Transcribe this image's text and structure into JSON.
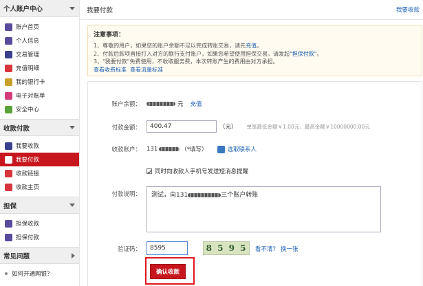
{
  "sidebar": {
    "sections": [
      {
        "title": "个人账户中心",
        "items": [
          {
            "label": "账户首页",
            "icon": "home-icon"
          },
          {
            "label": "个人信息",
            "icon": "user-icon"
          },
          {
            "label": "交易管理",
            "icon": "transaction-icon"
          },
          {
            "label": "充值明细",
            "icon": "recharge-icon"
          },
          {
            "label": "我的银行卡",
            "icon": "bank-card-icon"
          },
          {
            "label": "电子对账单",
            "icon": "statement-icon"
          },
          {
            "label": "安全中心",
            "icon": "security-icon"
          }
        ]
      },
      {
        "title": "收款付款",
        "items": [
          {
            "label": "我要收款",
            "icon": "receive-icon"
          },
          {
            "label": "我要付款",
            "icon": "pay-icon",
            "active": true
          },
          {
            "label": "收款链接",
            "icon": "link-icon"
          },
          {
            "label": "收款主页",
            "icon": "homepage-icon"
          }
        ]
      },
      {
        "title": "担保",
        "items": [
          {
            "label": "担保收款",
            "icon": "guarantee-receive-icon"
          },
          {
            "label": "担保付款",
            "icon": "guarantee-pay-icon"
          }
        ]
      },
      {
        "title": "常见问题",
        "items": [
          {
            "label": "如何开通网银？"
          }
        ]
      }
    ]
  },
  "header": {
    "title": "我要付款",
    "right_link": "我要收款"
  },
  "notice": {
    "title": "注意事项：",
    "line1_a": "1、尊敬的用户，如果您的账户余额不足以完成转账交易，请先",
    "line1_link": "充值",
    "line1_b": "。",
    "line2_a": "2、付款后款项直接打入对方的联行支付账户，如果您希望使用担保交易，请发起",
    "line2_link": "\"担保付款\"",
    "line2_b": "。",
    "line3": "3、\"我要付款\"免费使用，不收取服务费，本次转账产生的费用由对方承担。",
    "link_a": "查看收费标准",
    "link_b": "查看流量标准"
  },
  "form": {
    "balance_label": "账户余额：",
    "balance_unit": "元",
    "recharge_link": "充值",
    "amount_label": "付款金额：",
    "amount_value": "400.47",
    "amount_unit": "（元）",
    "amount_hint": "单笔最低金额￥1.00元，最高金额￥10000000.00元",
    "account_label": "收款账户：",
    "account_prefix": "131",
    "account_note": "（*填写）",
    "select_contact": "选取联系人",
    "sms_notify": "同时向收款人手机号发送短消息提醒",
    "remark_label": "付款说明：",
    "remark_prefix": "测试，向131",
    "remark_suffix": "三个账户转账",
    "captcha_label": "验证码：",
    "captcha_value": "8595",
    "captcha_image": [
      "8",
      "5",
      "9",
      "5"
    ],
    "captcha_refresh_a": "看不清？",
    "captcha_refresh_b": "换一张",
    "submit": "确认收款"
  }
}
